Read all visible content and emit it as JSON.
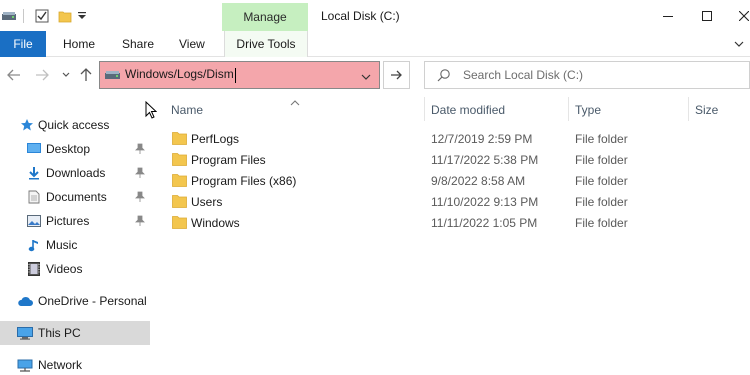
{
  "titlebar": {
    "context_tab": "Manage",
    "window_title": "Local Disk (C:)",
    "quick_access_icons": [
      "drive-icon",
      "properties-icon",
      "new-folder-icon",
      "customize-dropdown-icon"
    ]
  },
  "ribbon": {
    "file_label": "File",
    "tabs": [
      "Home",
      "Share",
      "View"
    ],
    "drive_tools_label": "Drive Tools"
  },
  "navbar": {
    "address_value": "Windows/Logs/Dism",
    "search_placeholder": "Search Local Disk (C:)"
  },
  "sidebar": {
    "items": [
      {
        "label": "Quick access",
        "icon": "star-icon"
      },
      {
        "label": "Desktop",
        "icon": "desktop-icon",
        "pinned": true
      },
      {
        "label": "Downloads",
        "icon": "download-icon",
        "pinned": true
      },
      {
        "label": "Documents",
        "icon": "document-icon",
        "pinned": true
      },
      {
        "label": "Pictures",
        "icon": "picture-icon",
        "pinned": true
      },
      {
        "label": "Music",
        "icon": "music-icon"
      },
      {
        "label": "Videos",
        "icon": "video-icon"
      },
      {
        "label": "OneDrive - Personal",
        "icon": "cloud-icon"
      },
      {
        "label": "This PC",
        "icon": "computer-icon",
        "selected": true
      },
      {
        "label": "Network",
        "icon": "network-icon"
      }
    ]
  },
  "columns": {
    "name": "Name",
    "date": "Date modified",
    "type": "Type",
    "size": "Size"
  },
  "files": [
    {
      "name": "PerfLogs",
      "date": "12/7/2019 2:59 PM",
      "type": "File folder"
    },
    {
      "name": "Program Files",
      "date": "11/17/2022 5:38 PM",
      "type": "File folder"
    },
    {
      "name": "Program Files (x86)",
      "date": "9/8/2022 8:58 AM",
      "type": "File folder"
    },
    {
      "name": "Users",
      "date": "11/10/2022 9:13 PM",
      "type": "File folder"
    },
    {
      "name": "Windows",
      "date": "11/11/2022 1:05 PM",
      "type": "File folder"
    }
  ],
  "colors": {
    "file_tab": "#1a6fc4",
    "manage_tab": "#c6efc0",
    "address_highlight": "#f4a6ab",
    "folder": "#f3c64e",
    "selected_item": "#d9d9d9"
  }
}
